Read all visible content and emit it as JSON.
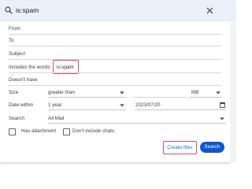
{
  "search": {
    "query": "is:spam"
  },
  "form": {
    "from_label": "From",
    "to_label": "To",
    "subject_label": "Subject",
    "has_words_label": "Includes the words",
    "has_words_value": "is:spam",
    "doesnt_have_label": "Doesn't have",
    "size_label": "Size",
    "size_operator": "greater than",
    "size_unit": "MB",
    "date_within_label": "Date within",
    "date_within_value": "1 year",
    "date_value": "2023/07/20",
    "search_label": "Search",
    "search_scope": "All Mail",
    "has_attachment_label": "Has attachment",
    "no_chats_label": "Don't include chats"
  },
  "buttons": {
    "create_filter": "Create filter",
    "search": "Search"
  },
  "colors": {
    "highlight": "#e8476b",
    "accent": "#0b57d0",
    "topbar": "#eaf1fb"
  },
  "icons": [
    "search-icon",
    "close-icon",
    "chevron-down-icon",
    "calendar-icon"
  ]
}
